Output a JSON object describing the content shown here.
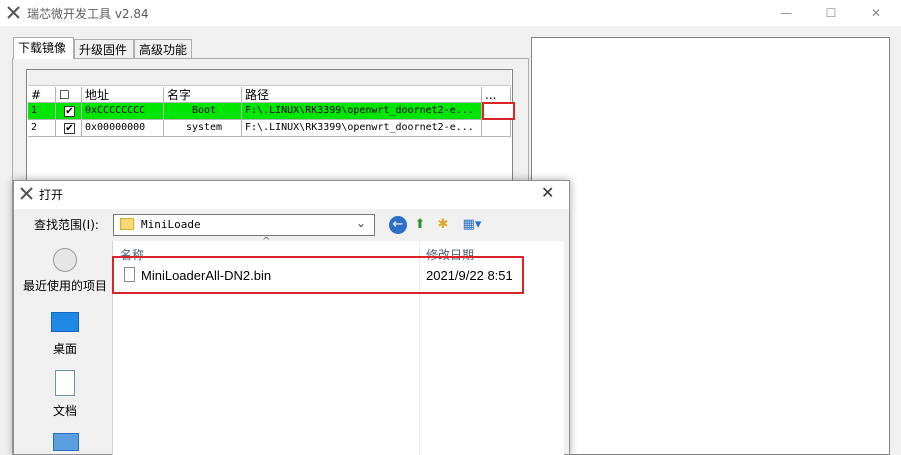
{
  "window": {
    "title": "瑞芯微开发工具 v2.84",
    "controls": [
      "—",
      "☐",
      "✕"
    ]
  },
  "tabs": [
    {
      "label": "下载镜像",
      "active": true
    },
    {
      "label": "升级固件",
      "active": false
    },
    {
      "label": "高级功能",
      "active": false
    }
  ],
  "grid": {
    "headers": {
      "num": "#",
      "check": "☐",
      "address": "地址",
      "name": "名字",
      "path": "路径",
      "more": "..."
    },
    "rows": [
      {
        "num": "1",
        "checked": "✔",
        "address": "0xCCCCCCCC",
        "name": "Boot",
        "path": "F:\\.LINUX\\RK3399\\openwrt_doornet2-e...",
        "selected": true
      },
      {
        "num": "2",
        "checked": "✔",
        "address": "0x00000000",
        "name": "system",
        "path": "F:\\.LINUX\\RK3399\\openwrt_doornet2-e...",
        "selected": false
      }
    ]
  },
  "dialog": {
    "title": "打开",
    "lookin_label": "查找范围(I):",
    "lookin_value": "MiniLoade",
    "toolbar_icons": [
      "back-icon",
      "up-folder-icon",
      "new-folder-icon",
      "view-menu-icon"
    ],
    "places": [
      {
        "label": "最近使用的项目",
        "icon": "recent-icon"
      },
      {
        "label": "桌面",
        "icon": "desktop-icon"
      },
      {
        "label": "文档",
        "icon": "documents-icon"
      },
      {
        "label": "",
        "icon": "computer-icon"
      }
    ],
    "columns": {
      "name": "名称",
      "date": "修改日期"
    },
    "files": [
      {
        "name": "MiniLoaderAll-DN2.bin",
        "modified": "2021/9/22 8:51"
      }
    ]
  },
  "colors": {
    "selected_row": "#00e600",
    "highlight_box": "#d9242a",
    "accent": "#0078d7"
  }
}
